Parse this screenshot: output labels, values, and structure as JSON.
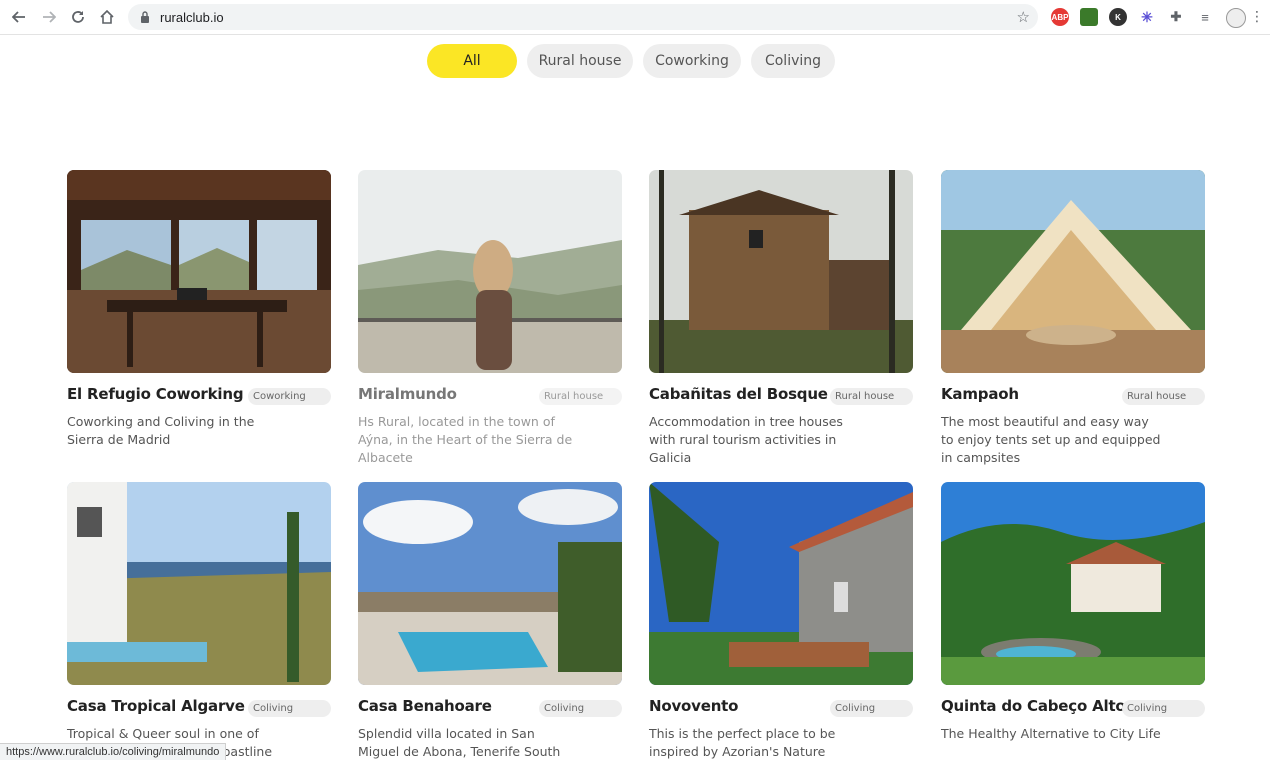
{
  "browser": {
    "url": "ruralclub.io",
    "status_url": "https://www.ruralclub.io/coliving/miralmundo"
  },
  "filters": [
    {
      "label": "All",
      "active": true
    },
    {
      "label": "Rural house",
      "active": false
    },
    {
      "label": "Coworking",
      "active": false
    },
    {
      "label": "Coliving",
      "active": false
    }
  ],
  "cards": [
    {
      "title": "El Refugio Coworking",
      "badge": "Coworking",
      "desc": "Coworking and Coliving in the Sierra de Madrid"
    },
    {
      "title": "Miralmundo",
      "badge": "Rural house",
      "desc": "Hs Rural, located in the town of Aýna, in the Heart of the Sierra de Albacete"
    },
    {
      "title": "Cabañitas del Bosque",
      "badge": "Rural house",
      "desc": "Accommodation in tree houses with rural tourism activities in Galicia"
    },
    {
      "title": "Kampaoh",
      "badge": "Rural house",
      "desc": "The most beautiful and easy way to enjoy tents set up and equipped in campsites"
    },
    {
      "title": "Casa Tropical Algarve",
      "badge": "Coliving",
      "desc": "Tropical & Queer soul in one of Europe's last unspoiled coastline"
    },
    {
      "title": "Casa Benahoare",
      "badge": "Coliving",
      "desc": "Splendid villa located in San Miguel de Abona, Tenerife South"
    },
    {
      "title": "Novovento",
      "badge": "Coliving",
      "desc": "This is the perfect place to be inspired by Azorian's Nature"
    },
    {
      "title": "Quinta do Cabeço Alto",
      "badge": "Coliving",
      "desc": "The Healthy Alternative to City Life"
    }
  ],
  "icons": [
    "back-arrow-icon",
    "forward-arrow-icon",
    "reload-icon",
    "home-icon",
    "lock-icon",
    "star-icon",
    "adblock-icon",
    "extension-icon",
    "profile-icon"
  ],
  "colors": {
    "accent": "#fbe625",
    "pill_bg": "#eeeeee"
  }
}
